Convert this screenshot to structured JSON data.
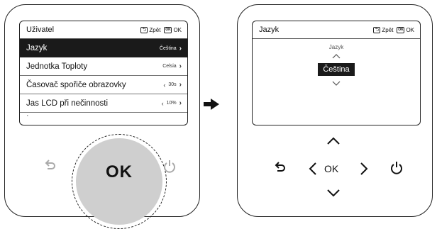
{
  "left_screen": {
    "title": "Uživatel",
    "back_label": "Zpět",
    "ok_label": "OK",
    "back_icon": "back-arrow-icon",
    "ok_icon": "ok-key-icon",
    "menu_items": [
      {
        "label": "Jazyk",
        "value": "Čeština",
        "selected": true
      },
      {
        "label": "Jednotka Toploty",
        "value": "Celsia",
        "selected": false
      },
      {
        "label": "Časovač spořiče obrazovky",
        "value": "30s",
        "selected": false
      },
      {
        "label": "Jas LCD při nečinnosti",
        "value": "10%",
        "selected": false
      }
    ]
  },
  "left_device": {
    "ok_button": "OK",
    "ok_icon_box": "OK",
    "back_icon": "back-arrow-icon",
    "power_icon": "power-icon"
  },
  "right_screen": {
    "title": "Jazyk",
    "back_label": "Zpět",
    "ok_label": "OK",
    "picker_label": "Jazyk",
    "picker_value": "Čeština"
  },
  "right_device": {
    "ok_button": "OK",
    "ok_icon_box": "OK",
    "icons": [
      "up-arrow-icon",
      "down-arrow-icon",
      "left-arrow-icon",
      "right-arrow-icon",
      "back-arrow-icon",
      "power-icon"
    ]
  },
  "colors": {
    "selection": "#1a1a1a",
    "ok_button": "#cfcfcf",
    "inactive_icon": "#aaaaaa"
  }
}
